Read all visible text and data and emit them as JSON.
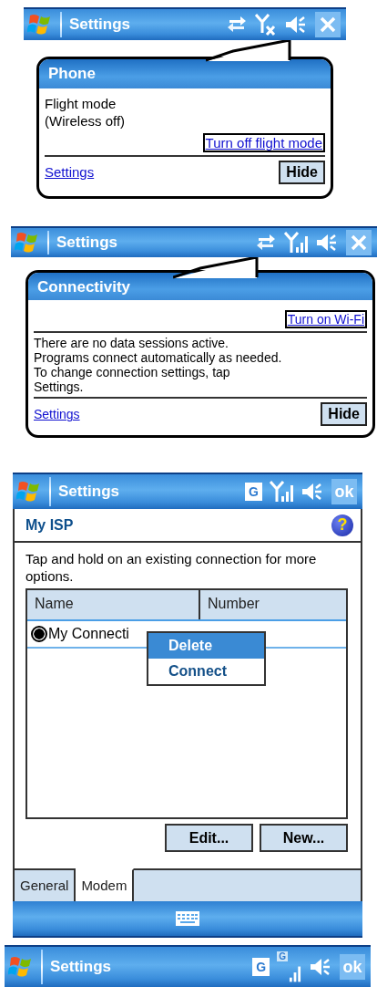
{
  "screens": [
    {
      "kind": "balloon",
      "title_bar": {
        "title": "Settings",
        "status_icons": [
          {
            "kind": "sync"
          },
          {
            "kind": "signal-off"
          },
          {
            "kind": "speaker"
          }
        ],
        "action": {
          "kind": "close"
        }
      },
      "balloon": {
        "kind": "message-first",
        "title": "Phone",
        "message_lines": [
          "Flight mode",
          "(Wireless off)"
        ],
        "action_link": "Turn off flight mode",
        "settings_link": "Settings",
        "hide_button": "Hide"
      }
    },
    {
      "kind": "balloon",
      "title_bar": {
        "title": "Settings",
        "status_icons": [
          {
            "kind": "sync"
          },
          {
            "kind": "signal"
          },
          {
            "kind": "speaker"
          }
        ],
        "action": {
          "kind": "close"
        }
      },
      "balloon": {
        "kind": "link-first",
        "title": "Connectivity",
        "message_lines": [
          "There are no data sessions active.",
          "Programs connect automatically as needed.",
          "To change connection settings, tap",
          "Settings."
        ],
        "action_link": "Turn on Wi-Fi",
        "settings_link": "Settings",
        "hide_button": "Hide"
      }
    },
    {
      "kind": "form",
      "title_bar": {
        "title": "Settings",
        "status_icons": [
          {
            "kind": "badge",
            "text": "G"
          },
          {
            "kind": "signal"
          },
          {
            "kind": "speaker"
          }
        ],
        "action": {
          "kind": "ok",
          "label": "ok"
        }
      },
      "form": {
        "heading": "My ISP",
        "help": "?",
        "instruction": "Tap and hold on an existing connection for more options.",
        "columns": [
          "Name",
          "Number"
        ],
        "rows": [
          {
            "name": "My Connecti",
            "selected": true
          }
        ],
        "context_menu": [
          {
            "label": "Delete",
            "selected": true
          },
          {
            "label": "Connect",
            "selected": false
          }
        ],
        "buttons": [
          "Edit...",
          "New..."
        ],
        "tabs": [
          {
            "label": "General",
            "selected": false
          },
          {
            "label": "Modem",
            "selected": true
          }
        ]
      }
    },
    {
      "kind": "titlebar-only",
      "title_bar": {
        "title": "Settings",
        "status_icons": [
          {
            "kind": "badge",
            "text": "G"
          },
          {
            "kind": "signal-g",
            "text": "G"
          },
          {
            "kind": "speaker"
          }
        ],
        "action": {
          "kind": "ok",
          "label": "ok"
        }
      }
    }
  ]
}
